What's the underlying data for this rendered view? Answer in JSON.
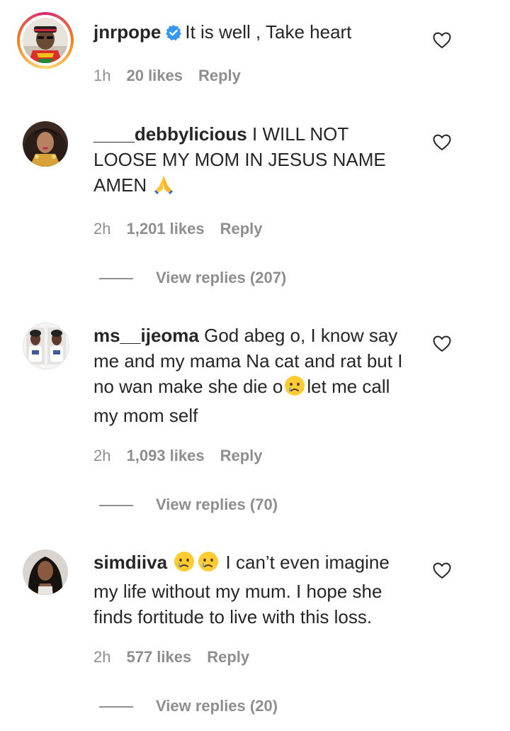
{
  "comments": [
    {
      "username": "jnrpope",
      "verified": true,
      "text": "It is well , Take heart",
      "time": "1h",
      "likes": "20 likes",
      "reply": "Reply"
    },
    {
      "username": "____debbylicious",
      "text": "I WILL NOT LOOSE MY MOM IN JESUS NAME AMEN",
      "emoji": "🙏",
      "time": "2h",
      "likes": "1,201 likes",
      "reply": "Reply",
      "view_replies": "View replies (207)"
    },
    {
      "username": "ms__ijeoma",
      "text_before": "God abeg o, I know say me and my mama Na cat and rat but I no wan make she die o",
      "emoji": "😢",
      "text_after": "let me call my mom self",
      "time": "2h",
      "likes": "1,093 likes",
      "reply": "Reply",
      "view_replies": "View replies (70)"
    },
    {
      "username": "simdiiva",
      "emoji": "😢😢",
      "text": "I can’t even imagine my life without my mum. I hope she finds fortitude to live with this loss.",
      "time": "2h",
      "likes": "577 likes",
      "reply": "Reply",
      "view_replies": "View replies (20)"
    }
  ],
  "icons": {
    "heart": "heart-outline-icon",
    "verified": "verified-badge-icon"
  },
  "colors": {
    "text": "#262626",
    "secondary": "#8e8e8e",
    "verified": "#3897f0"
  }
}
